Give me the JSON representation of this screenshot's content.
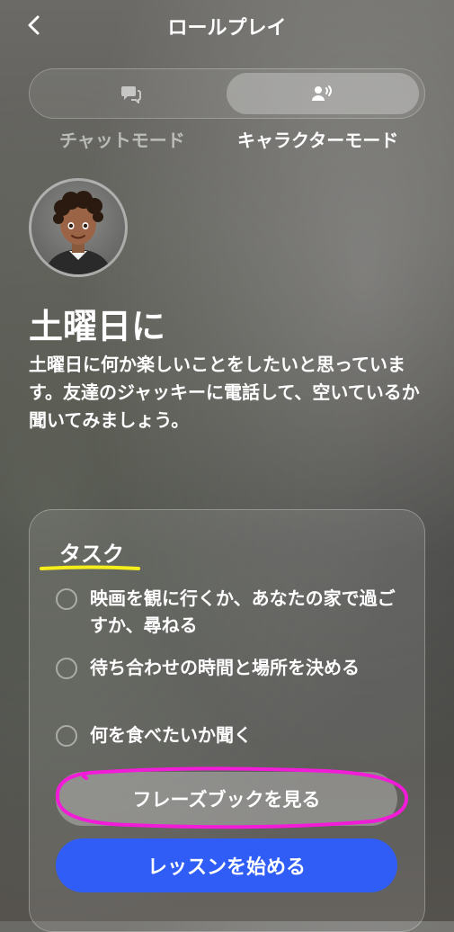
{
  "header": {
    "title": "ロールプレイ"
  },
  "modes": [
    {
      "label": "チャットモード",
      "icon": "chat-icon",
      "selected": false
    },
    {
      "label": "キャラクターモード",
      "icon": "voice-character-icon",
      "selected": true
    }
  ],
  "scene": {
    "title": "土曜日に",
    "description": "土曜日に何か楽しいことをしたいと思っています。友達のジャッキーに電話して、空いているか聞いてみましょう。"
  },
  "tasks": {
    "heading": "タスク",
    "items": [
      "映画を観に行くか、あなたの家で過ごすか、尋ねる",
      "待ち合わせの時間と場所を決める",
      "何を食べたいか聞く"
    ]
  },
  "buttons": {
    "phrasebook": "フレーズブックを見る",
    "start": "レッスンを始める"
  },
  "colors": {
    "accent": "#2f5df5",
    "highlight_yellow": "#f5ee1b",
    "highlight_magenta": "#f21bd8"
  }
}
